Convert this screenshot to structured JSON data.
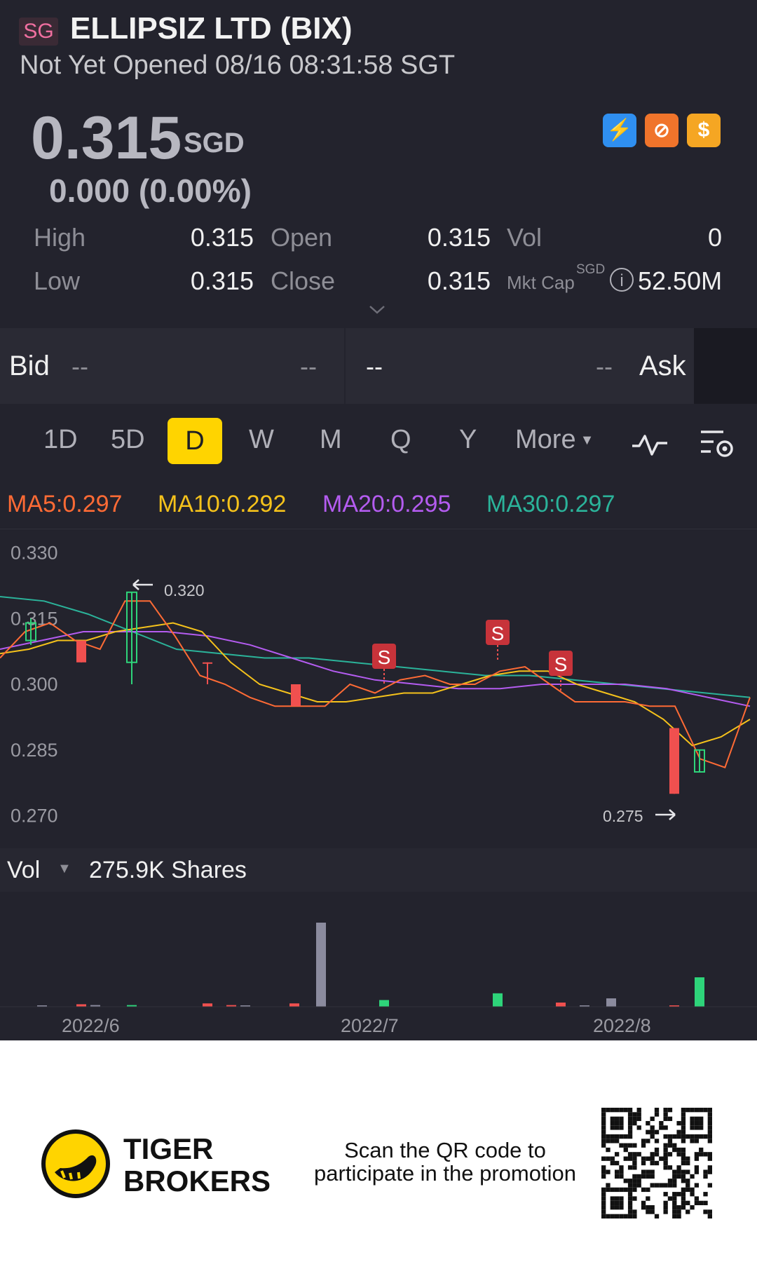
{
  "header": {
    "exchange_badge": "SG",
    "title": "ELLIPSIZ LTD (BIX)",
    "status": "Not Yet Opened 08/16 08:31:58 SGT",
    "price": "0.315",
    "currency": "SGD",
    "change": "0.000 (0.00%)",
    "icons": [
      "lightning-level-icon",
      "no-short-icon",
      "dollar-icon"
    ]
  },
  "quote": {
    "high_label": "High",
    "high": "0.315",
    "low_label": "Low",
    "low": "0.315",
    "open_label": "Open",
    "open": "0.315",
    "close_label": "Close",
    "close": "0.315",
    "vol_label": "Vol",
    "vol": "0",
    "mktcap_label": "Mkt Cap",
    "mktcap_unit": "SGD",
    "mktcap": "52.50M"
  },
  "orderbook": {
    "bid_label": "Bid",
    "bid_price": "--",
    "bid_size": "--",
    "ask_price": "--",
    "ask_size": "--",
    "ask_label": "Ask"
  },
  "tabs": {
    "items": [
      "1D",
      "5D",
      "D",
      "W",
      "M",
      "Q",
      "Y"
    ],
    "active": "D",
    "more": "More"
  },
  "ma": {
    "ma5": "MA5:0.297",
    "ma10": "MA10:0.292",
    "ma20": "MA20:0.295",
    "ma30": "MA30:0.297"
  },
  "colors": {
    "ma5": "#ff6b35",
    "ma10": "#f5c21b",
    "ma20": "#b45cf0",
    "ma30": "#2bb39a",
    "up": "#2ed47a",
    "down": "#f0504f",
    "neutral": "#8b8b9e"
  },
  "chart": {
    "y_ticks": [
      "0.330",
      "0.315",
      "0.300",
      "0.285",
      "0.270"
    ],
    "high_mark": "0.320",
    "low_mark": "0.275",
    "signal_label": "S",
    "x_ticks": [
      "2022/6",
      "2022/7",
      "2022/8"
    ]
  },
  "volume": {
    "label": "Vol",
    "value": "275.9K Shares"
  },
  "promo": {
    "brand_line1": "TIGER",
    "brand_line2": "BROKERS",
    "text_line1": "Scan the QR code to",
    "text_line2": "participate in the promotion"
  },
  "chart_data": {
    "type": "candlestick",
    "ylim": [
      0.268,
      0.332
    ],
    "candles": [
      {
        "o": 0.31,
        "c": 0.314,
        "h": 0.315,
        "l": 0.309,
        "d": "up"
      },
      {
        "o": 0.31,
        "c": 0.305,
        "h": 0.31,
        "l": 0.305,
        "d": "down"
      },
      {
        "o": 0.305,
        "c": 0.321,
        "h": 0.321,
        "l": 0.3,
        "d": "up"
      },
      {
        "o": 0.305,
        "c": 0.305,
        "h": 0.305,
        "l": 0.3,
        "d": "down"
      },
      {
        "o": 0.3,
        "c": 0.295,
        "h": 0.3,
        "l": 0.295,
        "d": "down"
      },
      {
        "o": 0.29,
        "c": 0.275,
        "h": 0.29,
        "l": 0.275,
        "d": "down"
      },
      {
        "o": 0.28,
        "c": 0.285,
        "h": 0.285,
        "l": 0.28,
        "d": "up"
      }
    ],
    "ma5": [
      0.306,
      0.312,
      0.314,
      0.31,
      0.308,
      0.319,
      0.319,
      0.311,
      0.302,
      0.3,
      0.297,
      0.295,
      0.295,
      0.295,
      0.3,
      0.298,
      0.301,
      0.302,
      0.3,
      0.3,
      0.303,
      0.304,
      0.3,
      0.296,
      0.296,
      0.296,
      0.295,
      0.295,
      0.283,
      0.281,
      0.297
    ],
    "ma10": [
      0.307,
      0.308,
      0.31,
      0.31,
      0.312,
      0.313,
      0.314,
      0.312,
      0.305,
      0.3,
      0.298,
      0.296,
      0.296,
      0.297,
      0.298,
      0.298,
      0.3,
      0.302,
      0.303,
      0.303,
      0.3,
      0.298,
      0.296,
      0.292,
      0.286,
      0.288,
      0.292
    ],
    "ma20": [
      0.308,
      0.31,
      0.312,
      0.312,
      0.312,
      0.311,
      0.309,
      0.306,
      0.303,
      0.301,
      0.3,
      0.299,
      0.299,
      0.3,
      0.3,
      0.3,
      0.299,
      0.297,
      0.295
    ],
    "ma30": [
      0.32,
      0.319,
      0.316,
      0.312,
      0.308,
      0.307,
      0.306,
      0.306,
      0.305,
      0.304,
      0.303,
      0.302,
      0.302,
      0.301,
      0.3,
      0.299,
      0.298,
      0.297
    ],
    "volume_bars": [
      {
        "v": 1,
        "d": "neutral"
      },
      {
        "v": 3,
        "d": "down"
      },
      {
        "v": 2,
        "d": "neutral"
      },
      {
        "v": 2,
        "d": "up"
      },
      {
        "v": 4,
        "d": "down"
      },
      {
        "v": 2,
        "d": "down"
      },
      {
        "v": 1,
        "d": "neutral"
      },
      {
        "v": 4,
        "d": "down"
      },
      {
        "v": 100,
        "d": "neutral"
      },
      {
        "v": 8,
        "d": "up"
      },
      {
        "v": 16,
        "d": "up"
      },
      {
        "v": 5,
        "d": "down"
      },
      {
        "v": 1,
        "d": "neutral"
      },
      {
        "v": 10,
        "d": "neutral"
      },
      {
        "v": 1,
        "d": "down"
      },
      {
        "v": 35,
        "d": "up"
      }
    ]
  }
}
